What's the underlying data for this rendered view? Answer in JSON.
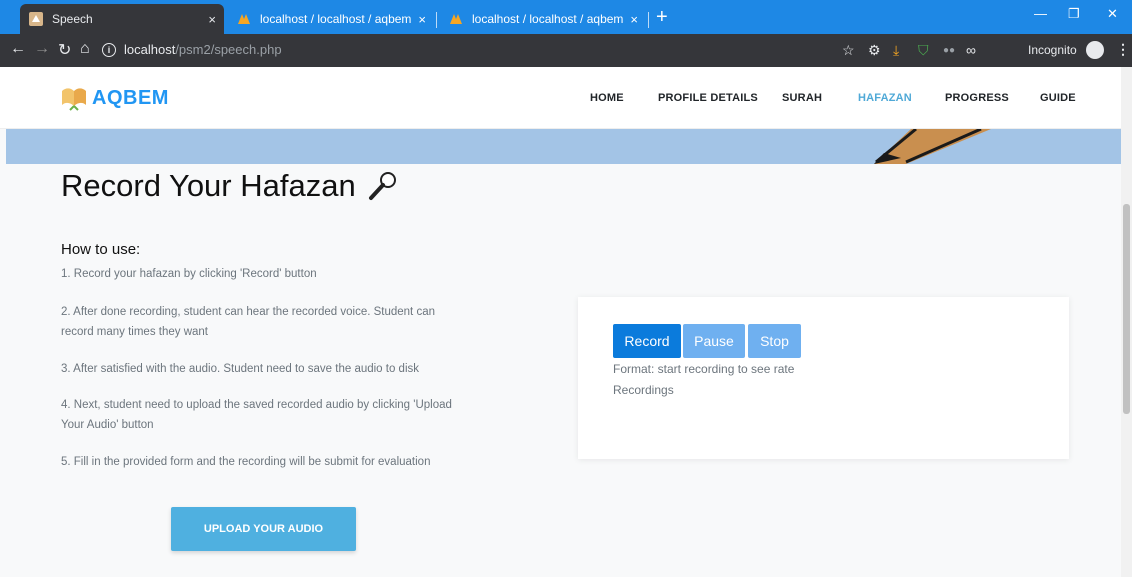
{
  "browser": {
    "tabs": [
      {
        "title": "Speech",
        "active": true
      },
      {
        "title": "localhost / localhost / aqbem / st",
        "active": false
      },
      {
        "title": "localhost / localhost / aqbem / st",
        "active": false
      }
    ],
    "new_tab_symbol": "+",
    "close_symbol": "×",
    "url_host": "localhost",
    "url_path": "/psm2/speech.php",
    "incognito_label": "Incognito",
    "tab_bar_color": "#1e88e5",
    "toolbar_color": "#35363a"
  },
  "site": {
    "logo_text": "AQBEM",
    "nav": [
      {
        "label": "HOME",
        "active": false
      },
      {
        "label": "PROFILE DETAILS",
        "active": false
      },
      {
        "label": "SURAH",
        "active": false
      },
      {
        "label": "HAFAZAN",
        "active": true
      },
      {
        "label": "PROGRESS",
        "active": false
      },
      {
        "label": "GUIDE",
        "active": false
      }
    ],
    "active_nav_color": "#4fa9d7"
  },
  "main": {
    "title": "Record Your Hafazan",
    "how_to_heading": "How to use:",
    "steps": [
      "1. Record your hafazan by clicking 'Record' button",
      "2. After done recording, student can hear the recorded voice. Student can record many times they want",
      "3. After satisfied with the audio. Student need to save the audio to disk",
      "4. Next, student need to upload the saved recorded audio by clicking 'Upload Your Audio' button",
      "5. Fill in the provided form and the recording will be submit for evaluation"
    ],
    "upload_button": "UPLOAD YOUR AUDIO"
  },
  "recorder": {
    "record_label": "Record",
    "pause_label": "Pause",
    "stop_label": "Stop",
    "format_text": "Format: start recording to see rate",
    "recordings_label": "Recordings",
    "primary_color": "#0b7bdc",
    "secondary_color": "#6fb0f0"
  }
}
